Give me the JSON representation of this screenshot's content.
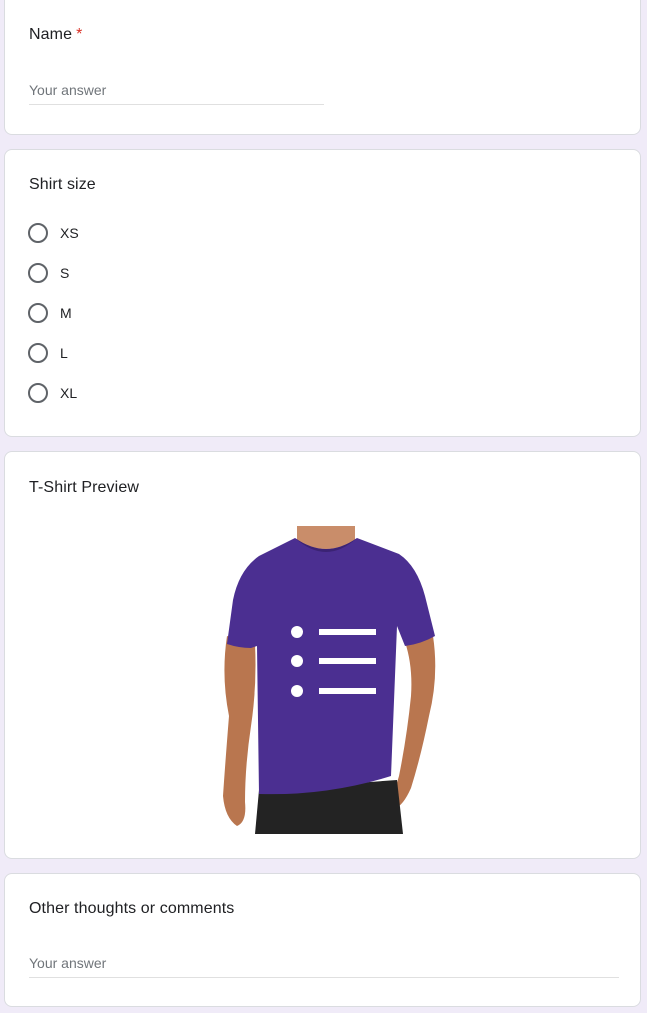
{
  "name_question": {
    "title": "Name",
    "required_mark": "*",
    "placeholder": "Your answer"
  },
  "size_question": {
    "title": "Shirt size",
    "options": [
      "XS",
      "S",
      "M",
      "L",
      "XL"
    ],
    "selected": null
  },
  "preview_section": {
    "title": "T-Shirt Preview",
    "shirt_color": "#4b2f91",
    "graphic": "list-icon",
    "graphic_color": "#ffffff"
  },
  "comments_question": {
    "title": "Other thoughts or comments",
    "placeholder": "Your answer"
  },
  "colors": {
    "page_background": "#f0ebf8",
    "card_background": "#ffffff",
    "required": "#d93025"
  }
}
